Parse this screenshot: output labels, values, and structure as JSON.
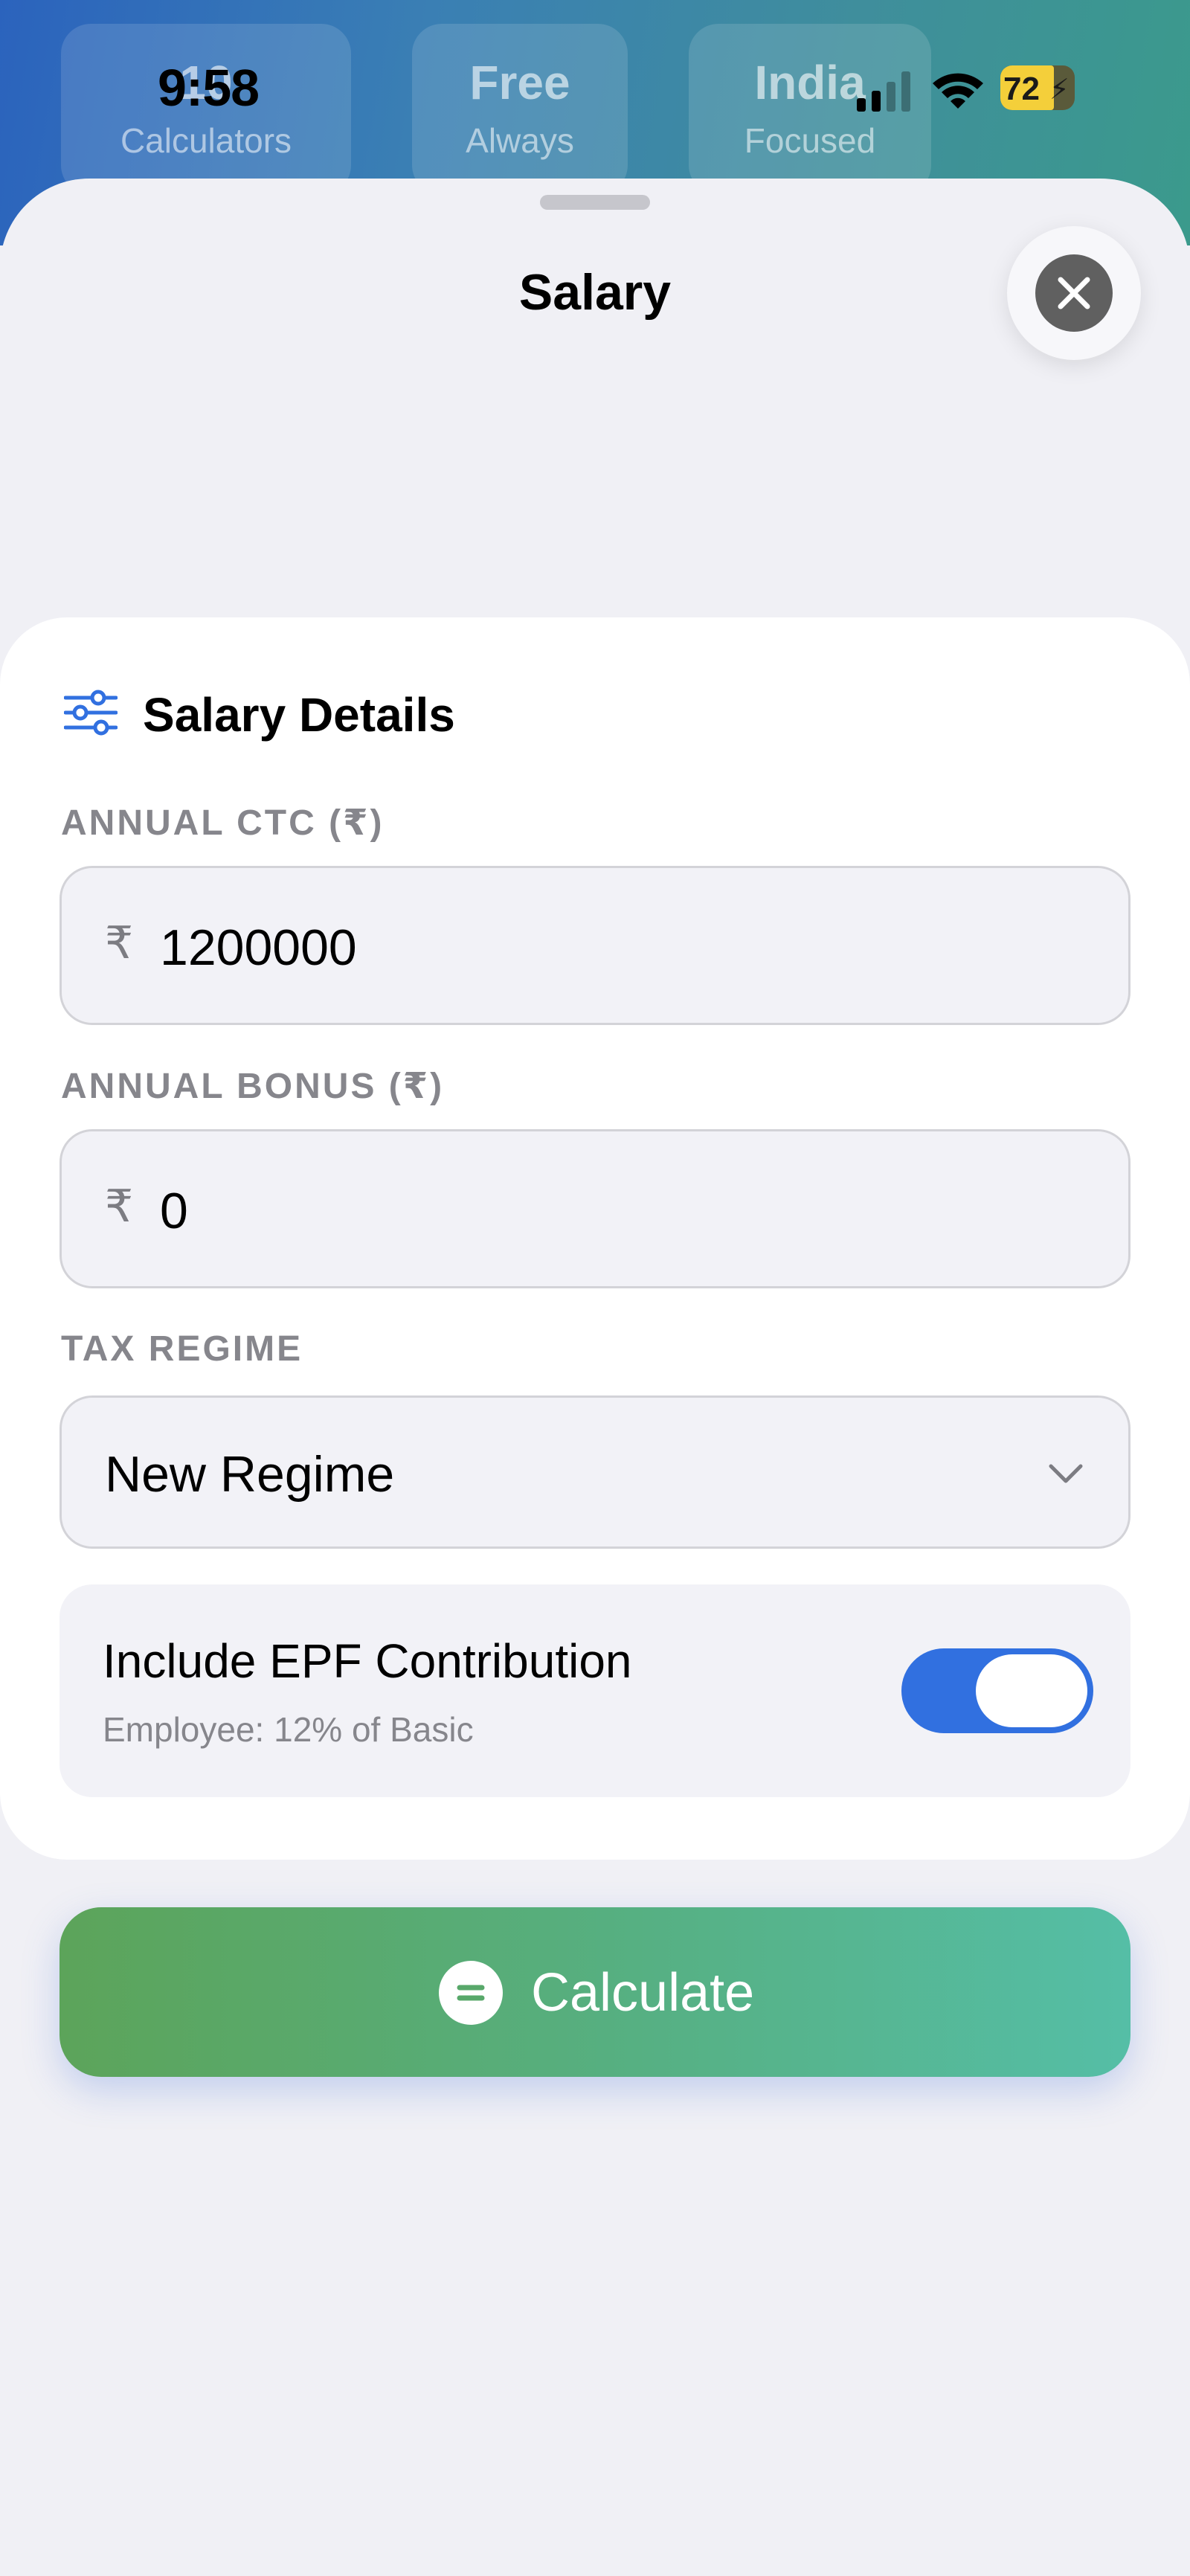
{
  "status_bar": {
    "time": "9:58",
    "battery": "72"
  },
  "background_stats": [
    {
      "value": "10",
      "label": "Calculators"
    },
    {
      "value": "Free",
      "label": "Always"
    },
    {
      "value": "India",
      "label": "Focused"
    }
  ],
  "sheet": {
    "title": "Salary"
  },
  "card": {
    "title": "Salary Details",
    "fields": {
      "ctc": {
        "label": "ANNUAL CTC (₹)",
        "currency": "₹",
        "value": "1200000"
      },
      "bonus": {
        "label": "ANNUAL BONUS (₹)",
        "currency": "₹",
        "value": "0"
      },
      "regime": {
        "label": "TAX REGIME",
        "value": "New Regime"
      }
    },
    "epf": {
      "title": "Include EPF Contribution",
      "subtitle": "Employee: 12% of Basic",
      "enabled": true
    }
  },
  "actions": {
    "calculate_label": "Calculate"
  },
  "colors": {
    "accent": "#3170e0",
    "calc_gradient_start": "#5ca45a",
    "calc_gradient_end": "#55bea6"
  }
}
